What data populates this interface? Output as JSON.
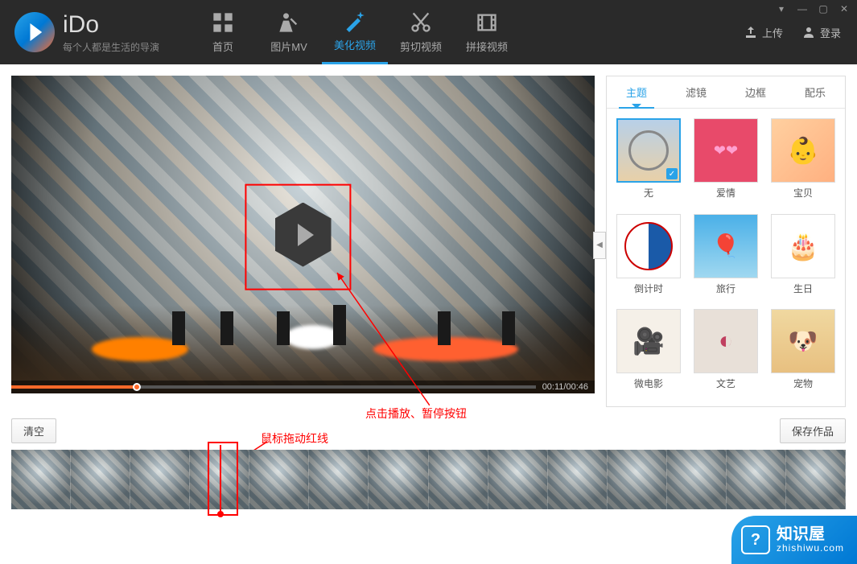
{
  "app": {
    "name": "iDo",
    "tagline": "每个人都是生活的导演"
  },
  "nav": {
    "items": [
      {
        "label": "首页"
      },
      {
        "label": "图片MV"
      },
      {
        "label": "美化视频"
      },
      {
        "label": "剪切视频"
      },
      {
        "label": "拼接视频"
      }
    ]
  },
  "header_actions": {
    "upload": "上传",
    "login": "登录"
  },
  "preview": {
    "current_time": "00:11",
    "total_time": "00:46"
  },
  "annotations": {
    "play_hint": "点击播放、暂停按钮",
    "drag_hint": "鼠标拖动红线"
  },
  "side_panel": {
    "tabs": [
      {
        "label": "主题"
      },
      {
        "label": "滤镜"
      },
      {
        "label": "边框"
      },
      {
        "label": "配乐"
      }
    ],
    "themes": [
      {
        "label": "无"
      },
      {
        "label": "爱情"
      },
      {
        "label": "宝贝"
      },
      {
        "label": "倒计时"
      },
      {
        "label": "旅行"
      },
      {
        "label": "生日"
      },
      {
        "label": "微电影"
      },
      {
        "label": "文艺"
      },
      {
        "label": "宠物"
      }
    ],
    "selected_theme_index": 0
  },
  "bottom": {
    "clear": "清空",
    "save": "保存作品"
  },
  "watermark": {
    "title": "知识屋",
    "url": "zhishiwu.com",
    "icon": "?"
  }
}
